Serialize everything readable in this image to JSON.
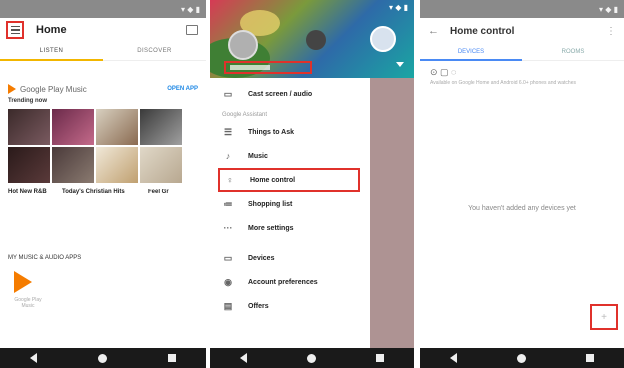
{
  "panel1": {
    "title": "Home",
    "tabs": [
      "LISTEN",
      "DISCOVER"
    ],
    "gpm_name": "Google Play Music",
    "open_app": "OPEN APP",
    "trending": "Trending now",
    "captions": [
      "Hot New R&B",
      "Today's Christian Hits",
      "Feel Gr"
    ],
    "apps_heading": "MY MUSIC & AUDIO APPS",
    "app_label": "Google Play Music"
  },
  "panel2": {
    "drawer_items": [
      {
        "icon": "cast-icon",
        "glyph": "▭",
        "label": "Cast screen / audio"
      },
      {
        "icon": "checklist-icon",
        "glyph": "☰",
        "label": "Things to Ask"
      },
      {
        "icon": "music-note-icon",
        "glyph": "♪",
        "label": "Music"
      },
      {
        "icon": "lightbulb-icon",
        "glyph": "♀",
        "label": "Home control"
      },
      {
        "icon": "list-icon",
        "glyph": "≔",
        "label": "Shopping list"
      },
      {
        "icon": "more-horizontal-icon",
        "glyph": "···",
        "label": "More settings"
      },
      {
        "icon": "devices-icon",
        "glyph": "▭",
        "label": "Devices"
      },
      {
        "icon": "account-icon",
        "glyph": "◉",
        "label": "Account preferences"
      },
      {
        "icon": "offers-icon",
        "glyph": "▤",
        "label": "Offers"
      }
    ],
    "section_label": "Google Assistant"
  },
  "panel3": {
    "title": "Home control",
    "tabs": [
      "DEVICES",
      "ROOMS"
    ],
    "device_icons": "⊙ ▢ ◌",
    "available_text": "Available on Google Home and Android 6.0+ phones and watches",
    "empty_message": "You haven't added any devices yet",
    "fab": "+"
  }
}
